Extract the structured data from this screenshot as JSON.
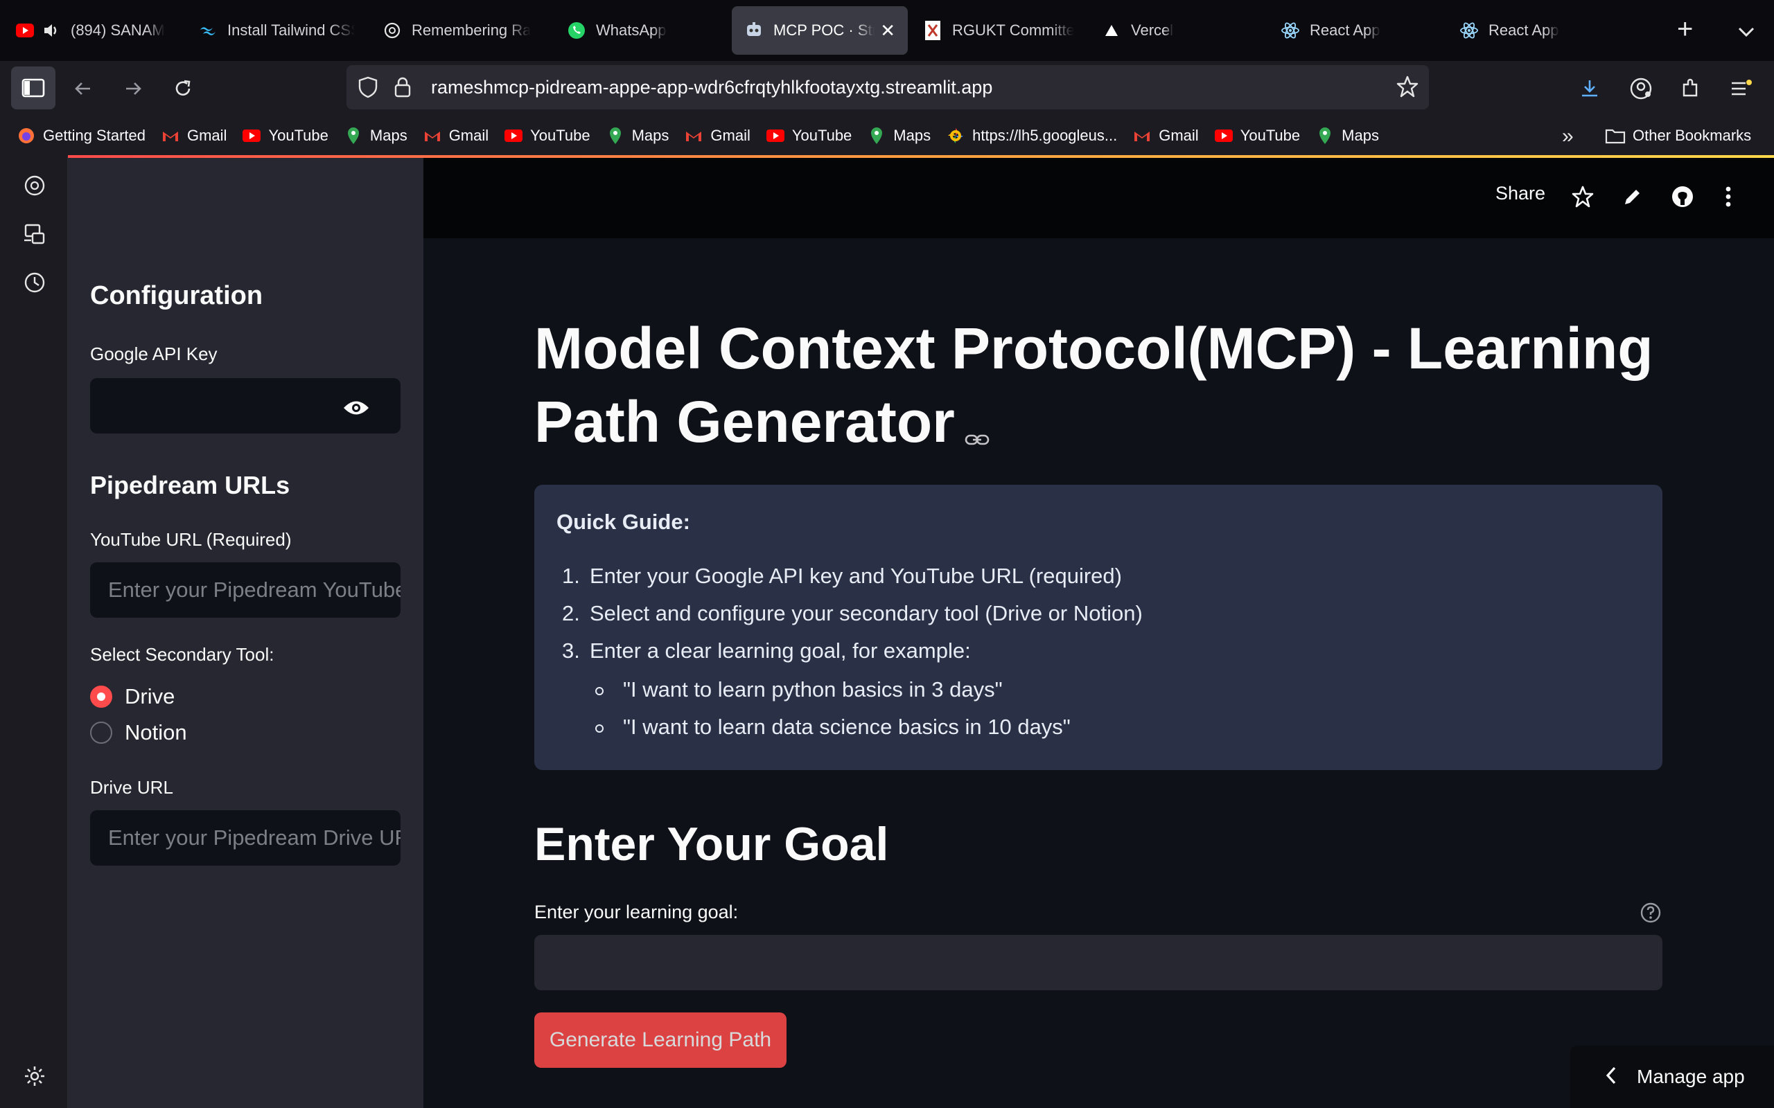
{
  "browser": {
    "tabs": [
      {
        "label": "(894) SANAM",
        "icon": "youtube-icon"
      },
      {
        "label": "Install Tailwind CSS",
        "icon": "tailwind-icon"
      },
      {
        "label": "Remembering Ra",
        "icon": "openai-icon"
      },
      {
        "label": "WhatsApp",
        "icon": "whatsapp-icon"
      },
      {
        "label": "MCP POC · Str",
        "icon": "streamlit-icon",
        "active": true
      },
      {
        "label": "RGUKT Committe",
        "icon": "rgukt-icon"
      },
      {
        "label": "Vercel",
        "icon": "vercel-icon"
      },
      {
        "label": "React App",
        "icon": "react-icon"
      },
      {
        "label": "React App",
        "icon": "react-icon"
      }
    ],
    "url": "rameshmcp-pidream-appe-app-wdr6cfrqtyhlkfootayxtg.streamlit.app",
    "bookmarks": [
      {
        "label": "Getting Started",
        "icon": "firefox-icon"
      },
      {
        "label": "Gmail",
        "icon": "gmail-icon"
      },
      {
        "label": "YouTube",
        "icon": "youtube-icon"
      },
      {
        "label": "Maps",
        "icon": "maps-icon"
      },
      {
        "label": "Gmail",
        "icon": "gmail-icon"
      },
      {
        "label": "YouTube",
        "icon": "youtube-icon"
      },
      {
        "label": "Maps",
        "icon": "maps-icon"
      },
      {
        "label": "Gmail",
        "icon": "gmail-icon"
      },
      {
        "label": "YouTube",
        "icon": "youtube-icon"
      },
      {
        "label": "Maps",
        "icon": "maps-icon"
      },
      {
        "label": "https://lh5.googleus...",
        "icon": "photos-icon"
      },
      {
        "label": "Gmail",
        "icon": "gmail-icon"
      },
      {
        "label": "YouTube",
        "icon": "youtube-icon"
      },
      {
        "label": "Maps",
        "icon": "maps-icon"
      }
    ],
    "other_bookmarks": "Other Bookmarks"
  },
  "header": {
    "share": "Share"
  },
  "sidebar": {
    "config_title": "Configuration",
    "api_key_label": "Google API Key",
    "pipedream_title": "Pipedream URLs",
    "youtube_label": "YouTube URL (Required)",
    "youtube_placeholder": "Enter your Pipedream YouTube URL",
    "secondary_label": "Select Secondary Tool:",
    "options": [
      {
        "label": "Drive",
        "selected": true
      },
      {
        "label": "Notion",
        "selected": false
      }
    ],
    "drive_label": "Drive URL",
    "drive_placeholder": "Enter your Pipedream Drive URL"
  },
  "main": {
    "title": "Model Context Protocol(MCP) - Learning Path Generator",
    "guide": {
      "title": "Quick Guide:",
      "steps": [
        {
          "num": "1.",
          "text": "Enter your Google API key and YouTube URL (required)"
        },
        {
          "num": "2.",
          "text": "Select and configure your secondary tool (Drive or Notion)"
        },
        {
          "num": "3.",
          "text": "Enter a clear learning goal, for example:"
        }
      ],
      "examples": [
        "\"I want to learn python basics in 3 days\"",
        "\"I want to learn data science basics in 10 days\""
      ]
    },
    "goal_heading": "Enter Your Goal",
    "goal_label": "Enter your learning goal:",
    "goal_value": "",
    "generate_button": "Generate Learning Path",
    "manage_app": "Manage app"
  },
  "colors": {
    "primary": "#ff4b4b",
    "background": "#0e1117",
    "sidebar": "#262730",
    "guide_bg": "#2a3147"
  }
}
